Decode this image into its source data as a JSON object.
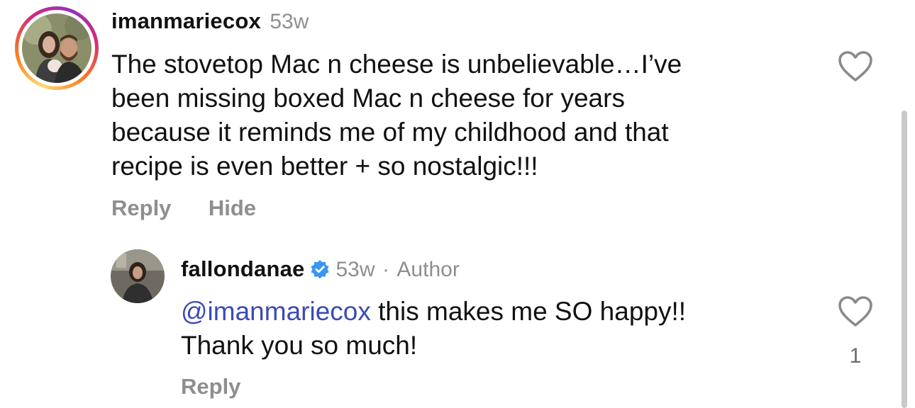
{
  "comment": {
    "username": "imanmariecox",
    "time": "53w",
    "text": "The stovetop Mac n cheese is unbelievable…I’ve\nbeen missing boxed Mac n cheese for years\nbecause it reminds me of my childhood and that\nrecipe is even better + so nostalgic!!!",
    "reply_label": "Reply",
    "hide_label": "Hide",
    "like_icon": "heart-outline-icon"
  },
  "reply": {
    "username": "fallondanae",
    "verified_icon": "verified-badge-icon",
    "time": "53w",
    "separator": "·",
    "role": "Author",
    "mention": "@imanmariecox",
    "text_line1": " this makes me SO happy!!",
    "text_line2": "Thank you so much!",
    "reply_label": "Reply",
    "like_icon": "heart-outline-icon",
    "like_count": "1"
  },
  "colors": {
    "text": "#111111",
    "secondary": "#8e8e8e",
    "mention": "#3b4ab8",
    "verified": "#3897f0"
  }
}
